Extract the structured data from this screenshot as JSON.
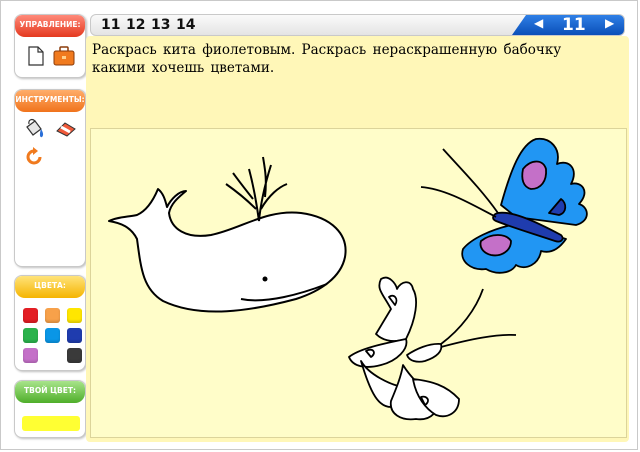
{
  "panels": {
    "control": {
      "title": "УПРАВЛЕНИЕ:",
      "icons": [
        "new-page-icon",
        "briefcase-icon"
      ]
    },
    "tools": {
      "title": "ИНСТРУМЕНТЫ:",
      "icons": [
        "paint-bucket-icon",
        "eraser-icon",
        "reset-icon"
      ]
    },
    "colors": {
      "title": "ЦВЕТА:",
      "swatches": [
        "#e31e24",
        "#f7a14a",
        "#ffe600",
        "#2bb24c",
        "#0a96e6",
        "#1f3cae",
        "#c470c8",
        "#3a3a3a"
      ]
    },
    "your_color": {
      "title": "ТВОЙ ЦВЕТ:",
      "value": "#ffff33"
    }
  },
  "topbar": {
    "pages": [
      "11",
      "12",
      "13",
      "14"
    ],
    "current_page": "11",
    "prev_icon": "triangle-left-icon",
    "next_icon": "triangle-right-icon"
  },
  "task": {
    "text": "Раскрась кита фиолетовым. Раскрась нераскрашенную бабочку какими хочешь цветами."
  },
  "canvas": {
    "items": [
      "whale",
      "butterfly-colored",
      "butterfly-uncolored"
    ]
  },
  "colors": {
    "accent_blue": "#0a4fb8",
    "canvas": "#fffdc9",
    "task_bg": "#fff7b8"
  }
}
